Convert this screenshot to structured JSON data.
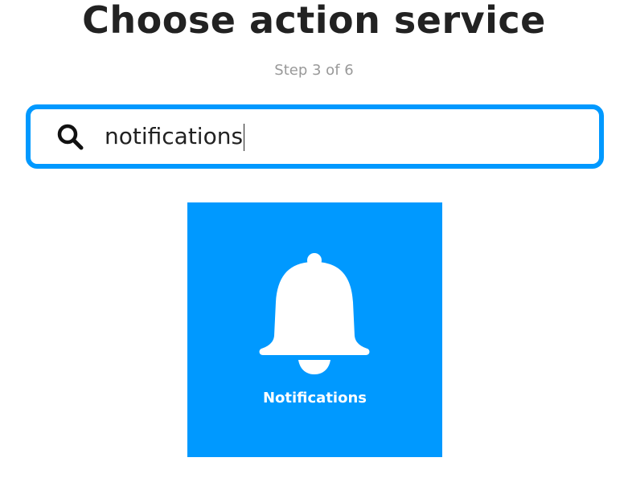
{
  "header": {
    "title": "Choose action service",
    "step": "Step 3 of 6"
  },
  "search": {
    "value": "notifications",
    "icon": "search-icon"
  },
  "results": [
    {
      "label": "Notifications",
      "icon": "bell-icon",
      "color": "#0099ff"
    }
  ],
  "colors": {
    "accent": "#0099ff",
    "title_text": "#222222",
    "step_text": "#999999"
  }
}
